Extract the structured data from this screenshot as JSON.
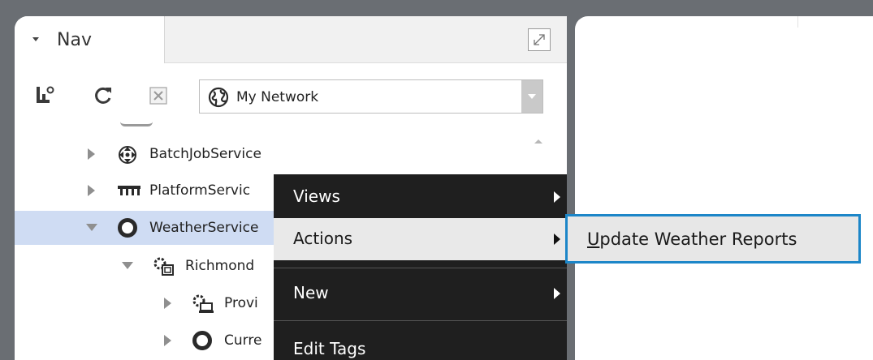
{
  "nav": {
    "title": "Nav",
    "network": {
      "selected": "My Network"
    },
    "toolbar": {
      "icons": [
        "nav-home-icon",
        "refresh-icon",
        "close-box-icon"
      ]
    },
    "tree": [
      {
        "label": "BatchJobService",
        "icon": "batch-job-icon",
        "expanded": false,
        "level": 0
      },
      {
        "label": "PlatformServic",
        "icon": "platform-icon",
        "expanded": false,
        "level": 0
      },
      {
        "label": "WeatherService",
        "icon": "weather-ring-icon",
        "expanded": true,
        "selected": true,
        "level": 0
      },
      {
        "label": "Richmond",
        "icon": "weather-station-icon",
        "expanded": true,
        "level": 1
      },
      {
        "label": "Provi",
        "icon": "weather-provider-icon",
        "expanded": false,
        "level": 2
      },
      {
        "label": "Curre",
        "icon": "weather-ring-icon",
        "expanded": false,
        "level": 2
      }
    ]
  },
  "context_menu": {
    "items": [
      {
        "label": "Views",
        "has_submenu": true
      },
      {
        "label": "Actions",
        "has_submenu": true,
        "highlighted": true
      },
      {
        "label": "New",
        "has_submenu": true
      },
      {
        "label": "Edit Tags",
        "has_submenu": false
      }
    ]
  },
  "submenu": {
    "item_mnemonic": "U",
    "item_rest": "pdate Weather Reports"
  },
  "colors": {
    "background": "#6a6e73",
    "selection": "#cfdcf3",
    "menu_bg": "#1f1f1f",
    "submenu_border": "#1c86c8"
  }
}
